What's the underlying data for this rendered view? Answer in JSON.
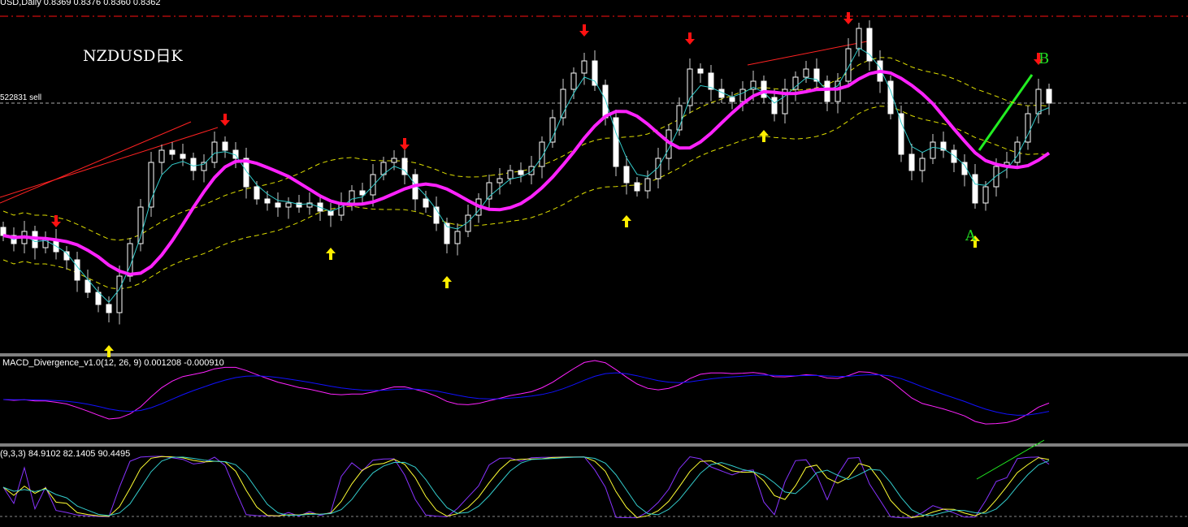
{
  "header": {
    "symbol_info": "USD,Daily  0.8369 0.8376 0.8360 0.8362"
  },
  "annotation": {
    "title": "NZDUSD日K",
    "label_a": "A",
    "label_b": "B",
    "sell_line": "522831 sell"
  },
  "macd_panel": {
    "label": "MACD_Divergence_v1.0(12, 26, 9) 0.001208 -0.000910"
  },
  "stoch_panel": {
    "label": "(9,3,3) 84.9102 82.1405 90.4495"
  },
  "colors": {
    "bg": "#000000",
    "bull": "#ffffff",
    "ma_slow": "#ff22ff",
    "ma_fast": "#33cccc",
    "band": "#dddd00",
    "up_arrow": "#ffee00",
    "down_arrow": "#ff1111",
    "macd": "#ff22ff",
    "signal": "#1111ff",
    "stoch_k": "#8833ff",
    "stoch_d": "#ffff33"
  },
  "chart_data": {
    "type": "candlestick",
    "title": "NZDUSD Daily",
    "ylim": [
      0.7746,
      0.8616
    ],
    "last_close": 0.8362,
    "resistance_level": 0.8576,
    "sell_level": 0.8362,
    "closes": [
      0.8036,
      0.8016,
      0.8046,
      0.8006,
      0.8026,
      0.7996,
      0.7976,
      0.7926,
      0.7896,
      0.7866,
      0.7846,
      0.7936,
      0.8016,
      0.8106,
      0.8216,
      0.8246,
      0.8236,
      0.8226,
      0.8196,
      0.8216,
      0.8266,
      0.8246,
      0.8226,
      0.8156,
      0.8126,
      0.8116,
      0.8106,
      0.8116,
      0.8106,
      0.8116,
      0.8096,
      0.8086,
      0.8116,
      0.8146,
      0.8136,
      0.8186,
      0.8216,
      0.8226,
      0.8186,
      0.8126,
      0.8106,
      0.8066,
      0.8016,
      0.8046,
      0.8086,
      0.8126,
      0.8166,
      0.8176,
      0.8196,
      0.8186,
      0.8206,
      0.8266,
      0.8326,
      0.8396,
      0.8436,
      0.8466,
      0.8406,
      0.8326,
      0.8206,
      0.8166,
      0.8146,
      0.8176,
      0.8226,
      0.8296,
      0.8356,
      0.8446,
      0.8436,
      0.8396,
      0.8376,
      0.8366,
      0.8396,
      0.8416,
      0.8376,
      0.8336,
      0.8396,
      0.8426,
      0.8446,
      0.8416,
      0.8366,
      0.8416,
      0.8496,
      0.8546,
      0.8466,
      0.8416,
      0.8336,
      0.8236,
      0.8196,
      0.8226,
      0.8266,
      0.8246,
      0.8216,
      0.8186,
      0.8116,
      0.8156,
      0.8206,
      0.8216,
      0.8266,
      0.8336,
      0.8396,
      0.8362
    ],
    "up_signals": [
      10,
      31,
      42,
      59,
      72,
      92
    ],
    "down_signals": [
      5,
      21,
      38,
      55,
      65,
      80,
      98
    ],
    "ma_fast_period": 3,
    "ma_slow_period": 8,
    "band_period": 20,
    "macd_params": [
      12,
      26,
      9
    ],
    "stoch_params": [
      9,
      3,
      3
    ]
  }
}
